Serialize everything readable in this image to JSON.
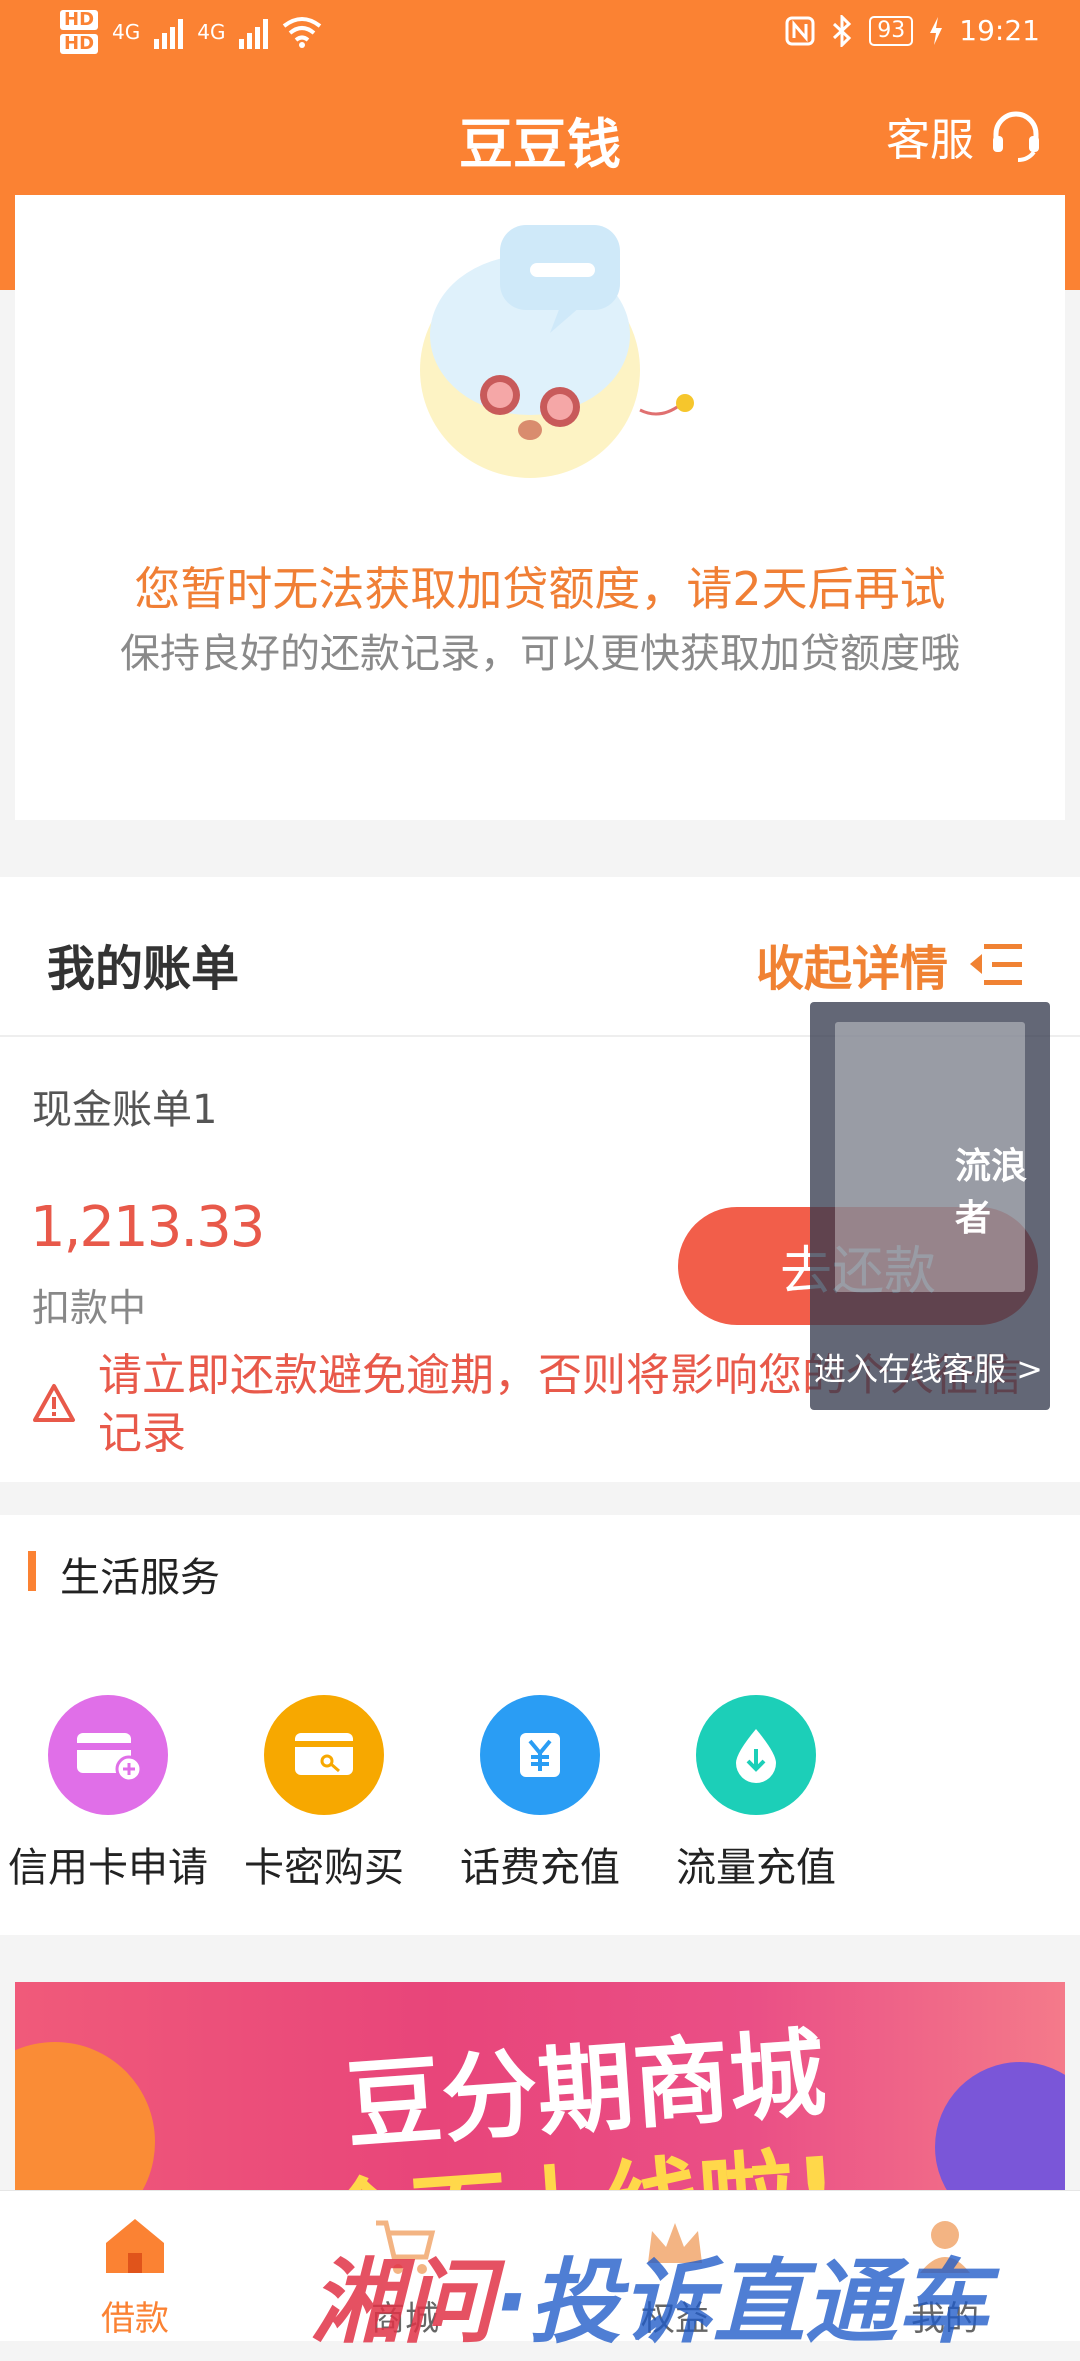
{
  "status_bar": {
    "hd1": "HD",
    "hd2": "HD",
    "net1": "4G",
    "net2": "4G",
    "battery": "93",
    "time": "19:21",
    "icons": [
      "nfc-icon",
      "bluetooth-icon",
      "wifi-icon",
      "charging-icon"
    ]
  },
  "header": {
    "title": "豆豆钱",
    "service_label": "客服",
    "service_icon": "headset-icon"
  },
  "notice": {
    "main": "您暂时无法获取加贷额度，请2天后再试",
    "sub": "保持良好的还款记录，可以更快获取加贷额度哦"
  },
  "bills": {
    "heading": "我的账单",
    "collapse_label": "收起详情",
    "bill_name": "现金账单1",
    "amount": "1,213.33",
    "status": "扣款中",
    "repay_button": "去还款",
    "warning": "请立即还款避免逾期，否则将影响您的个人征信记录"
  },
  "overlay": {
    "watermark": "流浪者",
    "link": "进入在线客服 >"
  },
  "life_services": {
    "heading": "生活服务",
    "items": [
      {
        "label": "信用卡申请",
        "icon": "credit-card-icon",
        "color": "#e06fe8"
      },
      {
        "label": "卡密购买",
        "icon": "key-card-icon",
        "color": "#f7a800"
      },
      {
        "label": "话费充值",
        "icon": "yuan-icon",
        "color": "#2a9df4"
      },
      {
        "label": "流量充值",
        "icon": "data-drop-icon",
        "color": "#1ccfb8"
      }
    ]
  },
  "banner": {
    "title": "豆分期商城",
    "subtitle": "全面上线啦!"
  },
  "tab_bar": {
    "items": [
      {
        "label": "借款",
        "icon": "home-icon",
        "active": true
      },
      {
        "label": "商城",
        "icon": "cart-icon",
        "active": false
      },
      {
        "label": "权益",
        "icon": "crown-icon",
        "active": false
      },
      {
        "label": "我的",
        "icon": "user-icon",
        "active": false
      }
    ]
  },
  "watermark": {
    "part1": "湘问",
    "part2": "·投诉直通车"
  },
  "colors": {
    "brand": "#fb8233",
    "alert": "#e8594a"
  }
}
